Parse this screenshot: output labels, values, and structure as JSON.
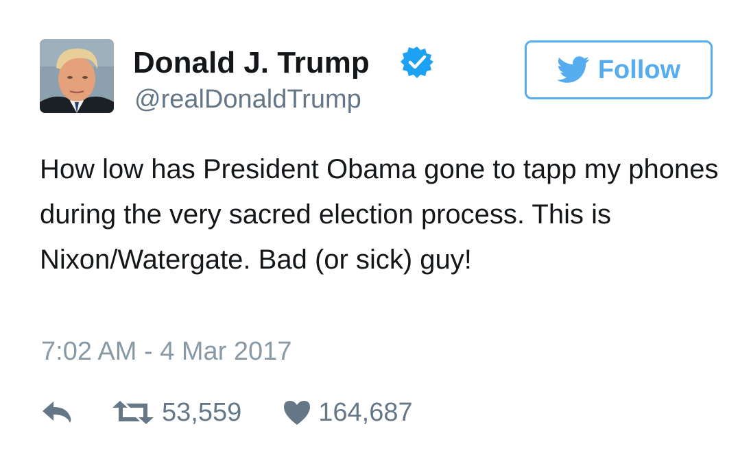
{
  "author": {
    "name": "Donald J. Trump",
    "handle": "@realDonaldTrump",
    "verified": true,
    "avatar_icon": "profile-photo"
  },
  "follow_button": {
    "label": "Follow",
    "icon": "twitter-bird-icon",
    "color": "#55acee"
  },
  "tweet": {
    "text": "How low has President Obama gone to tapp my phones during the very sacred election process. This is Nixon/Watergate. Bad (or sick) guy!",
    "timestamp": "7:02 AM - 4 Mar 2017"
  },
  "actions": {
    "reply_icon": "reply-icon",
    "retweet_icon": "retweet-icon",
    "retweet_count": "53,559",
    "like_icon": "heart-icon",
    "like_count": "164,687"
  },
  "colors": {
    "text": "#14171a",
    "secondary": "#657786",
    "timestamp": "#8899a6",
    "accent": "#55acee",
    "verified": "#1da1f2"
  }
}
